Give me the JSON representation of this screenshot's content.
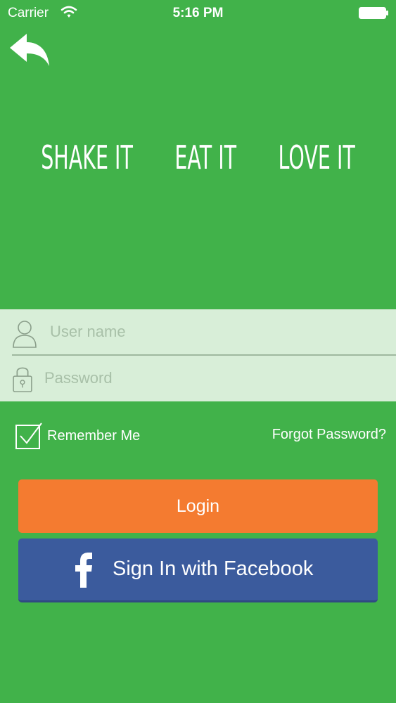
{
  "status_bar": {
    "carrier": "Carrier",
    "time": "5:16 PM",
    "wifi_icon": "wifi-icon",
    "battery_icon": "battery-icon"
  },
  "header": {
    "back_icon": "back-arrow-icon",
    "tagline": [
      "SHAKE IT",
      "EAT IT",
      "LOVE IT"
    ]
  },
  "form": {
    "username_placeholder": "User name",
    "username_value": "",
    "password_placeholder": "Password",
    "password_value": "",
    "username_icon": "user-icon",
    "password_icon": "lock-icon"
  },
  "options": {
    "remember_label": "Remember Me",
    "remember_checked": true,
    "forgot_label": "Forgot Password?"
  },
  "actions": {
    "login_label": "Login",
    "facebook_label": "Sign In with Facebook",
    "facebook_icon": "facebook-icon"
  },
  "colors": {
    "background": "#41b24a",
    "form_panel": "#d8eed8",
    "login": "#f47b30",
    "facebook": "#3b5b9d"
  }
}
